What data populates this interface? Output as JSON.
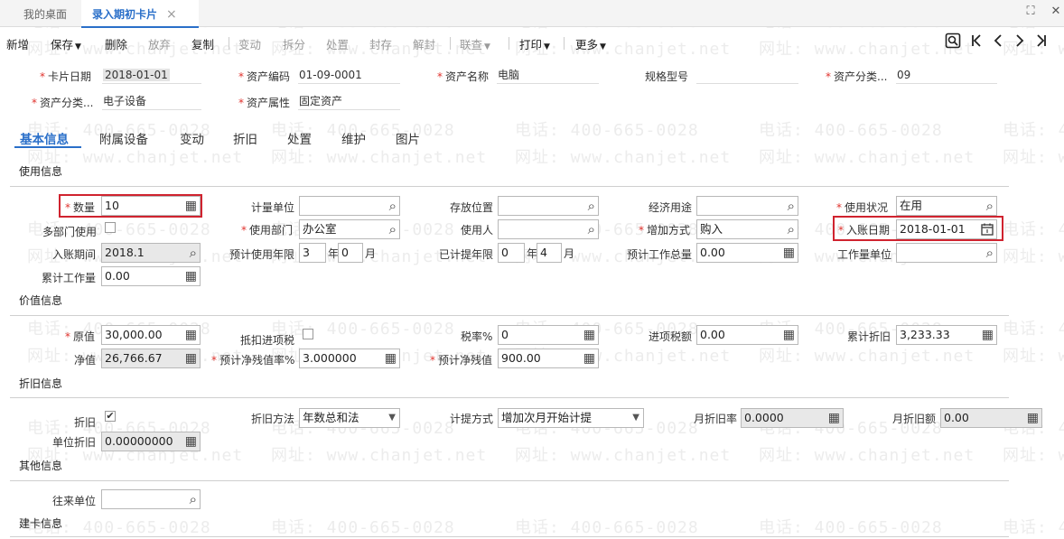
{
  "tabs": [
    {
      "label": "我的桌面"
    },
    {
      "label": "录入期初卡片",
      "close": "×"
    }
  ],
  "window": {
    "maximize": "⛶",
    "close": "✕"
  },
  "toolbar": {
    "new": "新增",
    "save": "保存",
    "delete": "删除",
    "discard": "放弃",
    "copy": "复制",
    "change": "变动",
    "split": "拆分",
    "dispose": "处置",
    "seal": "封存",
    "unseal": "解封",
    "query": "联查",
    "print": "打印",
    "more": "更多"
  },
  "header": {
    "card_date": {
      "label": "卡片日期",
      "value": "2018-01-01"
    },
    "asset_code": {
      "label": "资产编码",
      "value": "01-09-0001"
    },
    "asset_name": {
      "label": "资产名称",
      "value": "电脑"
    },
    "spec": {
      "label": "规格型号",
      "value": ""
    },
    "asset_cat": {
      "label": "资产分类...",
      "value": "09"
    },
    "asset_cat_name": {
      "label": "资产分类...",
      "value": "电子设备"
    },
    "asset_attr": {
      "label": "资产属性",
      "value": "固定资产"
    }
  },
  "detail_tabs": [
    "基本信息",
    "附属设备",
    "变动",
    "折旧",
    "处置",
    "维护",
    "图片"
  ],
  "usage": {
    "title": "使用信息",
    "qty": {
      "label": "数量",
      "value": "10"
    },
    "unit_measure": {
      "label": "计量单位",
      "value": ""
    },
    "storage": {
      "label": "存放位置",
      "value": ""
    },
    "econ_use": {
      "label": "经济用途",
      "value": ""
    },
    "use_status": {
      "label": "使用状况",
      "value": "在用"
    },
    "multi_dept": {
      "label": "多部门使用"
    },
    "dept": {
      "label": "使用部门",
      "value": "办公室"
    },
    "user": {
      "label": "使用人",
      "value": ""
    },
    "add_method": {
      "label": "增加方式",
      "value": "购入"
    },
    "entry_date": {
      "label": "入账日期",
      "value": "2018-01-01"
    },
    "entry_period": {
      "label": "入账期间",
      "value": "2018.1"
    },
    "life": {
      "label": "预计使用年限",
      "years": "3",
      "months": "0",
      "year_unit": "年",
      "month_unit": "月"
    },
    "accrued": {
      "label": "已计提年限",
      "years": "0",
      "months": "4",
      "year_unit": "年",
      "month_unit": "月"
    },
    "total_work": {
      "label": "预计工作总量",
      "value": "0.00"
    },
    "work_unit": {
      "label": "工作量单位",
      "value": ""
    },
    "cum_work": {
      "label": "累计工作量",
      "value": "0.00"
    }
  },
  "value_info": {
    "title": "价值信息",
    "original": {
      "label": "原值",
      "value": "30,000.00"
    },
    "deduct_tax": {
      "label": "抵扣进项税"
    },
    "tax_rate": {
      "label": "税率%",
      "value": "0"
    },
    "input_tax": {
      "label": "进项税额",
      "value": "0.00"
    },
    "cum_dep": {
      "label": "累计折旧",
      "value": "3,233.33"
    },
    "net": {
      "label": "净值",
      "value": "26,766.67"
    },
    "salvage_rate": {
      "label": "预计净残值率%",
      "value": "3.000000"
    },
    "salvage": {
      "label": "预计净残值",
      "value": "900.00"
    }
  },
  "dep_info": {
    "title": "折旧信息",
    "dep": {
      "label": "折旧",
      "check": "✔"
    },
    "method": {
      "label": "折旧方法",
      "value": "年数总和法"
    },
    "calc": {
      "label": "计提方式",
      "value": "增加次月开始计提"
    },
    "month_rate": {
      "label": "月折旧率",
      "value": "0.0000"
    },
    "month_amt": {
      "label": "月折旧额",
      "value": "0.00"
    },
    "unit_dep": {
      "label": "单位折旧",
      "value": "0.00000000"
    }
  },
  "other": {
    "title": "其他信息",
    "partner": {
      "label": "往来单位",
      "value": ""
    }
  },
  "build": {
    "title": "建卡信息"
  },
  "watermark": {
    "phone": "电话: 400-665-0028",
    "site": "网址: www.chanjet.net"
  }
}
